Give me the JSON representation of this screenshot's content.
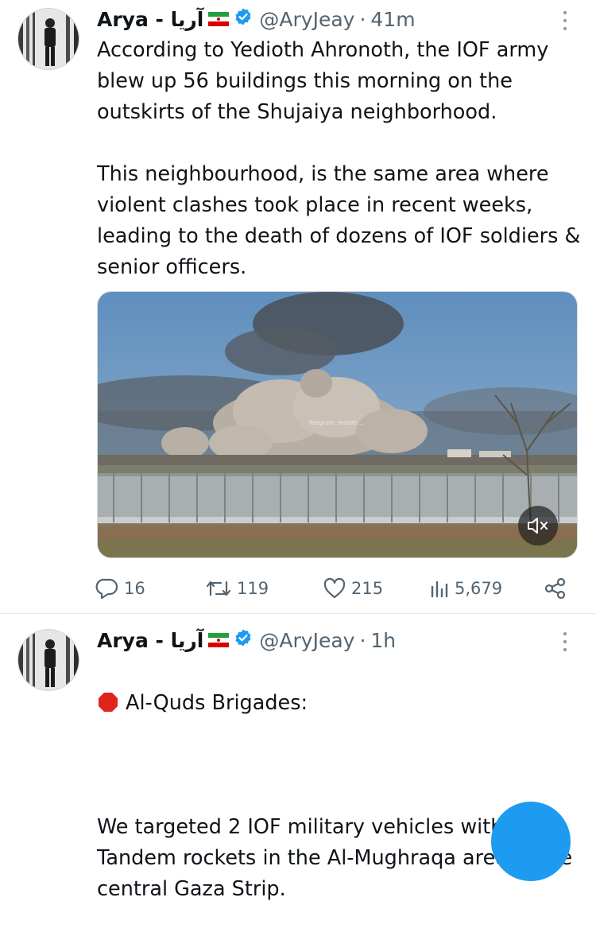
{
  "tweets": [
    {
      "author_name": "Arya - آریا",
      "flag_icon": "iran-flag-icon",
      "verified_icon": "verified-badge-icon",
      "handle": "@AryJeay",
      "separator": "·",
      "time": "41m",
      "text": "According to Yedioth Ahronoth, the IOF army blew up 56 buildings this morning on the outskirts of the Shujaiya neighborhood.\n\nThis neighbourhood, is the same area where violent clashes took place in recent weeks, leading to the death of dozens of IOF soldiers & senior officers.",
      "media_watermark": "Telegram: Yedioth…",
      "media_icon": "muted-speaker-icon",
      "actions": {
        "replies": "16",
        "retweets": "119",
        "likes": "215",
        "views": "5,679"
      }
    },
    {
      "author_name": "Arya - آریا",
      "flag_icon": "iran-flag-icon",
      "verified_icon": "verified-badge-icon",
      "handle": "@AryJeay",
      "separator": "·",
      "time": "1h",
      "line1_icon": "stop-sign-icon",
      "line1": "Al-Quds Brigades:",
      "text": "We targeted 2 IOF military vehicles with Tandem rockets in the Al-Mughraqa area in the central Gaza Strip."
    }
  ],
  "colors": {
    "text": "#0f1419",
    "muted": "#536471",
    "verified": "#1d9bf0",
    "stop": "#e0241b"
  }
}
